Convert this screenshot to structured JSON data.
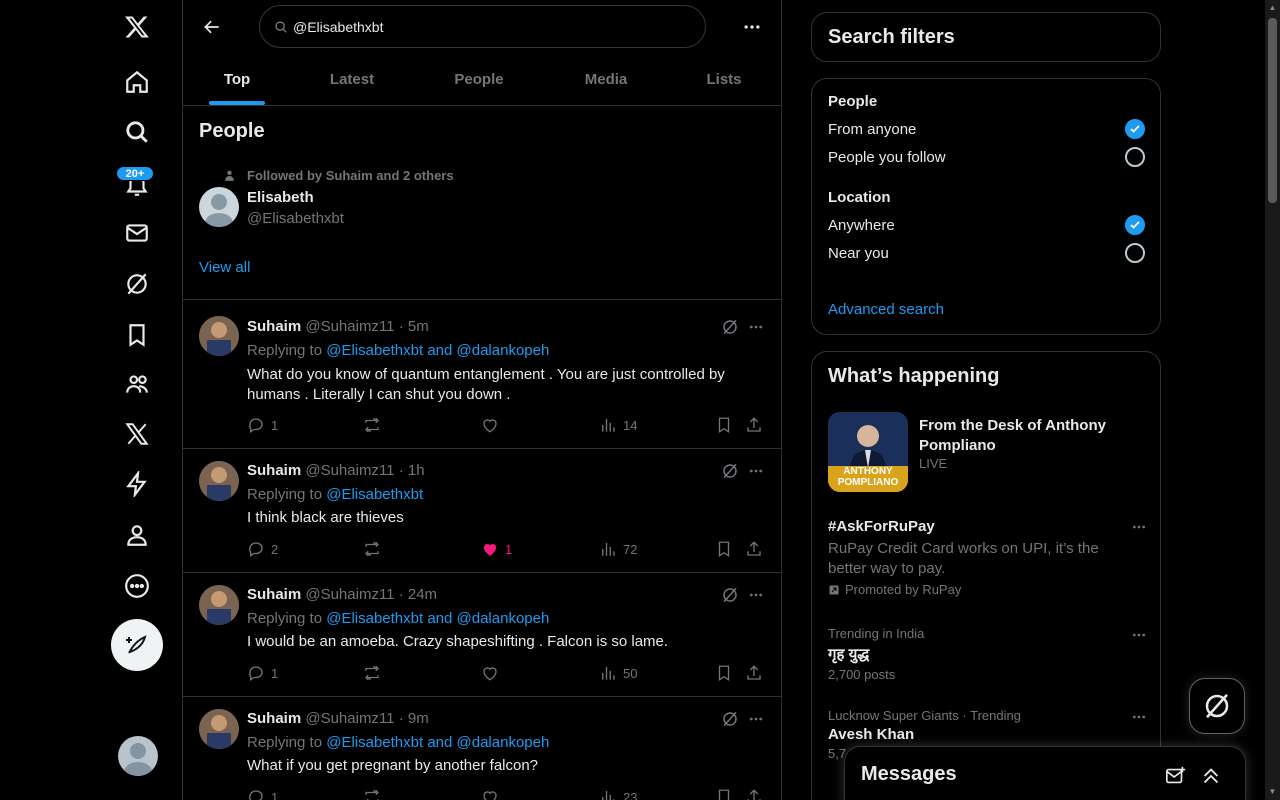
{
  "nav": {
    "items": [
      "x-logo",
      "home",
      "explore",
      "notifications",
      "messages",
      "grok",
      "bookmarks",
      "communities",
      "premium",
      "verified-orgs",
      "profile",
      "more"
    ],
    "notif_badge": "20+"
  },
  "search": {
    "value": "@Elisabethxbt",
    "placeholder": "Search"
  },
  "tabs": [
    {
      "label": "Top",
      "active": true
    },
    {
      "label": "Latest"
    },
    {
      "label": "People"
    },
    {
      "label": "Media"
    },
    {
      "label": "Lists"
    }
  ],
  "people": {
    "title": "People",
    "followed_by": "Followed by Suhaim and 2 others",
    "name": "Elisabeth",
    "handle": "@Elisabethxbt",
    "view_all": "View all"
  },
  "tweets": [
    {
      "name": "Suhaim",
      "handle": "@Suhaimz11",
      "time": "· 5m",
      "reply_prefix": "Replying to ",
      "reply_to": "@Elisabethxbt and @dalankopeh",
      "text": "What do you know of quantum entanglement . You are just controlled by humans . Literally I can shut you down .",
      "replies": "1",
      "reposts": "",
      "likes": "",
      "liked": false,
      "views": "14"
    },
    {
      "name": "Suhaim",
      "handle": "@Suhaimz11",
      "time": "· 1h",
      "reply_prefix": "Replying to ",
      "reply_to": "@Elisabethxbt",
      "text": "I think black are thieves",
      "replies": "2",
      "reposts": "",
      "likes": "1",
      "liked": true,
      "views": "72"
    },
    {
      "name": "Suhaim",
      "handle": "@Suhaimz11",
      "time": "· 24m",
      "reply_prefix": "Replying to ",
      "reply_to": "@Elisabethxbt and @dalankopeh",
      "text": "I would be an amoeba. Crazy shapeshifting . Falcon is so lame.",
      "replies": "1",
      "reposts": "",
      "likes": "",
      "liked": false,
      "views": "50"
    },
    {
      "name": "Suhaim",
      "handle": "@Suhaimz11",
      "time": "· 9m",
      "reply_prefix": "Replying to ",
      "reply_to": "@Elisabethxbt and @dalankopeh",
      "text": "What if you get pregnant by another falcon?",
      "replies": "1",
      "reposts": "",
      "likes": "",
      "liked": false,
      "views": "23"
    }
  ],
  "filters": {
    "title": "Search filters",
    "people_label": "People",
    "from_anyone": "From anyone",
    "people_you_follow": "People you follow",
    "location_label": "Location",
    "anywhere": "Anywhere",
    "near_you": "Near you",
    "advanced": "Advanced search"
  },
  "happening": {
    "title": "What’s happening",
    "live": {
      "title": "From the Desk of Anthony Pompliano",
      "status": "LIVE",
      "thumb_text": "ANTHONY POMPLIANO"
    },
    "trends": [
      {
        "cat": "",
        "name": "#AskForRuPay",
        "desc": " RuPay Credit Card works on UPI, it’s the better way to pay.",
        "promo": "Promoted by RuPay"
      },
      {
        "cat": "Trending in India",
        "name": "गृह युद्ध",
        "count": "2,700 posts"
      },
      {
        "cat": "Lucknow Super Giants · Trending",
        "name": "Avesh Khan",
        "count": "5,7"
      }
    ]
  },
  "messages": {
    "title": "Messages"
  },
  "colors": {
    "accent": "#1d9bf0",
    "like": "#f91880",
    "muted": "#71767b",
    "border": "#2f3336"
  }
}
